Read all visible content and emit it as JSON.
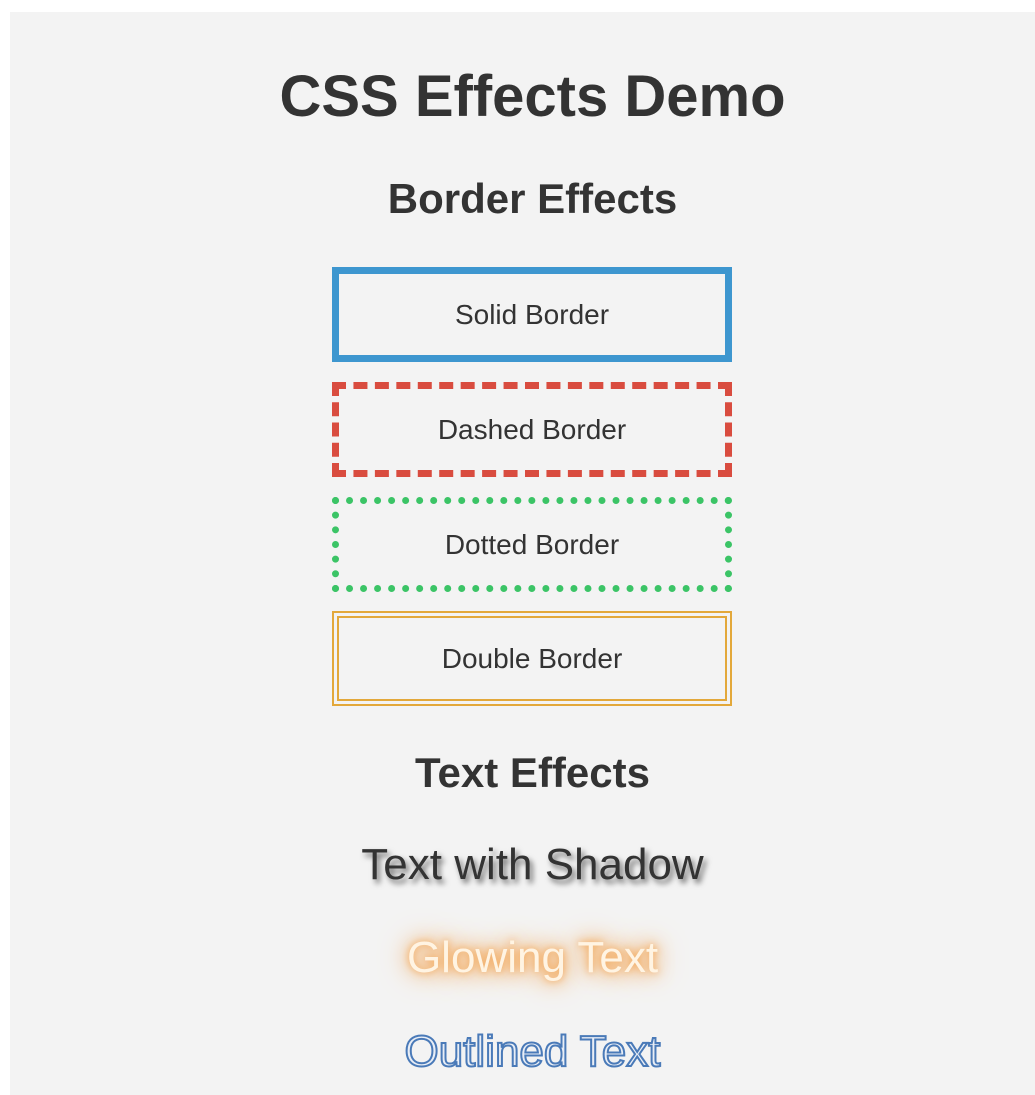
{
  "page": {
    "title": "CSS Effects Demo"
  },
  "border_section": {
    "heading": "Border Effects",
    "boxes": [
      {
        "label": "Solid Border",
        "color": "#3d96cf",
        "style": "solid"
      },
      {
        "label": "Dashed Border",
        "color": "#d94c3f",
        "style": "dashed"
      },
      {
        "label": "Dotted Border",
        "color": "#3bc466",
        "style": "dotted"
      },
      {
        "label": "Double Border",
        "color": "#e3a83a",
        "style": "double"
      }
    ]
  },
  "text_section": {
    "heading": "Text Effects",
    "shadow_text": "Text with Shadow",
    "glow_text": "Glowing Text",
    "glow_color": "#f5a24a",
    "outlined_text": "Outlined Text",
    "outline_color": "#4a7ab8"
  }
}
